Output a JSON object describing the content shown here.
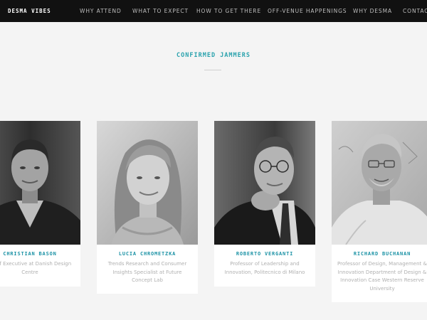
{
  "nav": {
    "brand": "DESMA VIBES",
    "items": [
      {
        "label": "WHY ATTEND"
      },
      {
        "label": "WHAT TO EXPECT"
      },
      {
        "label": "HOW TO GET THERE"
      },
      {
        "label": "OFF-VENUE HAPPENINGS"
      },
      {
        "label": "WHY DESMA"
      },
      {
        "label": "CONTACT"
      }
    ]
  },
  "section": {
    "title": "CONFIRMED JAMMERS"
  },
  "jammers": [
    {
      "name": "CHRISTIAN BASON",
      "description": "Chief Executive at Danish Design Centre"
    },
    {
      "name": "LUCIA CHROMETZKA",
      "description": "Trends Research and Consumer Insights Specialist at Future Concept Lab"
    },
    {
      "name": "ROBERTO VERGANTI",
      "description": "Professor of Leadership and Innovation, Politecnico di Milano"
    },
    {
      "name": "RICHARD BUCHANAN",
      "description": "Professor of Design, Management & Innovation Department of Design & Innovation Case Western Reserve University"
    }
  ]
}
